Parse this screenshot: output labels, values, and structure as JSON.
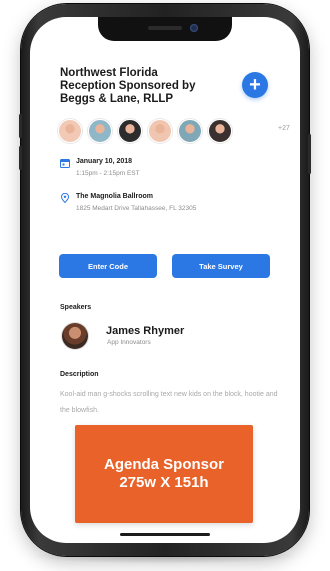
{
  "event": {
    "title_line1": "Northwest Florida",
    "title_line2": "Reception Sponsored by",
    "title_line3": "Beggs & Lane, RLLP",
    "add_icon": "plus-icon"
  },
  "attendees": {
    "extra_count": "+27",
    "avatar_colors": [
      "#f2c9b5",
      "#8fb7c8",
      "#2c2c2c",
      "#f1c6b0",
      "#7fa7b6",
      "#3a3030"
    ]
  },
  "details": {
    "date": "January 10, 2018",
    "time": "1:15pm - 2:15pm EST",
    "venue": "The Magnolia Ballroom",
    "address": "1825 Medart Drive Tallahassee, FL 32305",
    "date_icon": "calendar-icon",
    "location_icon": "location-pin-icon"
  },
  "actions": {
    "enter_code": "Enter Code",
    "take_survey": "Take Survey"
  },
  "speakers": {
    "label": "Speakers",
    "name": "James Rhymer",
    "company": "App Innovators"
  },
  "description": {
    "label": "Description",
    "text": "Kool-aid man g-shocks scrolling text new kids on the block, hootie and the blowfish."
  },
  "sponsor": {
    "line1": "Agenda Sponsor",
    "line2": "275w X 151h"
  },
  "colors": {
    "accent": "#2b78e4",
    "sponsor_bg": "#e8622a"
  }
}
